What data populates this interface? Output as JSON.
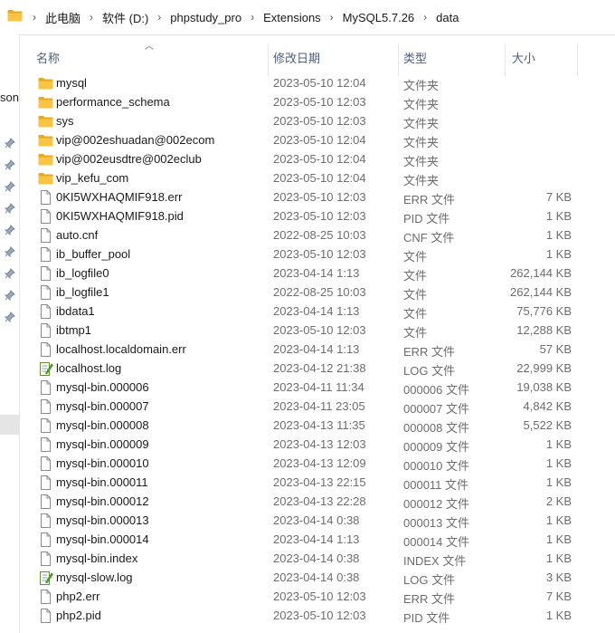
{
  "breadcrumb": [
    "此电脑",
    "软件 (D:)",
    "phpstudy_pro",
    "Extensions",
    "MySQL5.7.26",
    "data"
  ],
  "left_pane": {
    "partial_text": "sona"
  },
  "columns": {
    "name": "名称",
    "date": "修改日期",
    "type": "类型",
    "size": "大小"
  },
  "colors": {
    "folder": "#f8c443",
    "folder_dark": "#e8a823",
    "accent_header": "#4c607a"
  },
  "files": [
    {
      "name": "mysql",
      "date": "2023-05-10 12:04",
      "type": "文件夹",
      "size": "",
      "icon": "folder-icon"
    },
    {
      "name": "performance_schema",
      "date": "2023-05-10 12:03",
      "type": "文件夹",
      "size": "",
      "icon": "folder-icon"
    },
    {
      "name": "sys",
      "date": "2023-05-10 12:03",
      "type": "文件夹",
      "size": "",
      "icon": "folder-icon"
    },
    {
      "name": "vip@002eshuadan@002ecom",
      "date": "2023-05-10 12:04",
      "type": "文件夹",
      "size": "",
      "icon": "folder-icon"
    },
    {
      "name": "vip@002eusdtre@002eclub",
      "date": "2023-05-10 12:04",
      "type": "文件夹",
      "size": "",
      "icon": "folder-icon"
    },
    {
      "name": "vip_kefu_com",
      "date": "2023-05-10 12:04",
      "type": "文件夹",
      "size": "",
      "icon": "folder-icon"
    },
    {
      "name": "0KI5WXHAQMIF918.err",
      "date": "2023-05-10 12:03",
      "type": "ERR 文件",
      "size": "7 KB",
      "icon": "file-icon"
    },
    {
      "name": "0KI5WXHAQMIF918.pid",
      "date": "2023-05-10 12:03",
      "type": "PID 文件",
      "size": "1 KB",
      "icon": "file-icon"
    },
    {
      "name": "auto.cnf",
      "date": "2022-08-25 10:03",
      "type": "CNF 文件",
      "size": "1 KB",
      "icon": "file-icon"
    },
    {
      "name": "ib_buffer_pool",
      "date": "2023-05-10 12:03",
      "type": "文件",
      "size": "1 KB",
      "icon": "file-icon"
    },
    {
      "name": "ib_logfile0",
      "date": "2023-04-14 1:13",
      "type": "文件",
      "size": "262,144 KB",
      "icon": "file-icon"
    },
    {
      "name": "ib_logfile1",
      "date": "2022-08-25 10:03",
      "type": "文件",
      "size": "262,144 KB",
      "icon": "file-icon"
    },
    {
      "name": "ibdata1",
      "date": "2023-04-14 1:13",
      "type": "文件",
      "size": "75,776 KB",
      "icon": "file-icon"
    },
    {
      "name": "ibtmp1",
      "date": "2023-05-10 12:03",
      "type": "文件",
      "size": "12,288 KB",
      "icon": "file-icon"
    },
    {
      "name": "localhost.localdomain.err",
      "date": "2023-04-14 1:13",
      "type": "ERR 文件",
      "size": "57 KB",
      "icon": "file-icon"
    },
    {
      "name": "localhost.log",
      "date": "2023-04-12 21:38",
      "type": "LOG 文件",
      "size": "22,999 KB",
      "icon": "log-file-icon"
    },
    {
      "name": "mysql-bin.000006",
      "date": "2023-04-11 11:34",
      "type": "000006 文件",
      "size": "19,038 KB",
      "icon": "file-icon"
    },
    {
      "name": "mysql-bin.000007",
      "date": "2023-04-11 23:05",
      "type": "000007 文件",
      "size": "4,842 KB",
      "icon": "file-icon"
    },
    {
      "name": "mysql-bin.000008",
      "date": "2023-04-13 11:35",
      "type": "000008 文件",
      "size": "5,522 KB",
      "icon": "file-icon"
    },
    {
      "name": "mysql-bin.000009",
      "date": "2023-04-13 12:03",
      "type": "000009 文件",
      "size": "1 KB",
      "icon": "file-icon"
    },
    {
      "name": "mysql-bin.000010",
      "date": "2023-04-13 12:09",
      "type": "000010 文件",
      "size": "1 KB",
      "icon": "file-icon"
    },
    {
      "name": "mysql-bin.000011",
      "date": "2023-04-13 22:15",
      "type": "000011 文件",
      "size": "1 KB",
      "icon": "file-icon"
    },
    {
      "name": "mysql-bin.000012",
      "date": "2023-04-13 22:28",
      "type": "000012 文件",
      "size": "2 KB",
      "icon": "file-icon"
    },
    {
      "name": "mysql-bin.000013",
      "date": "2023-04-14 0:38",
      "type": "000013 文件",
      "size": "1 KB",
      "icon": "file-icon"
    },
    {
      "name": "mysql-bin.000014",
      "date": "2023-04-14 1:13",
      "type": "000014 文件",
      "size": "1 KB",
      "icon": "file-icon"
    },
    {
      "name": "mysql-bin.index",
      "date": "2023-04-14 0:38",
      "type": "INDEX 文件",
      "size": "1 KB",
      "icon": "file-icon"
    },
    {
      "name": "mysql-slow.log",
      "date": "2023-04-14 0:38",
      "type": "LOG 文件",
      "size": "3 KB",
      "icon": "log-file-icon"
    },
    {
      "name": "php2.err",
      "date": "2023-05-10 12:03",
      "type": "ERR 文件",
      "size": "7 KB",
      "icon": "file-icon"
    },
    {
      "name": "php2.pid",
      "date": "2023-05-10 12:03",
      "type": "PID 文件",
      "size": "1 KB",
      "icon": "file-icon"
    }
  ]
}
